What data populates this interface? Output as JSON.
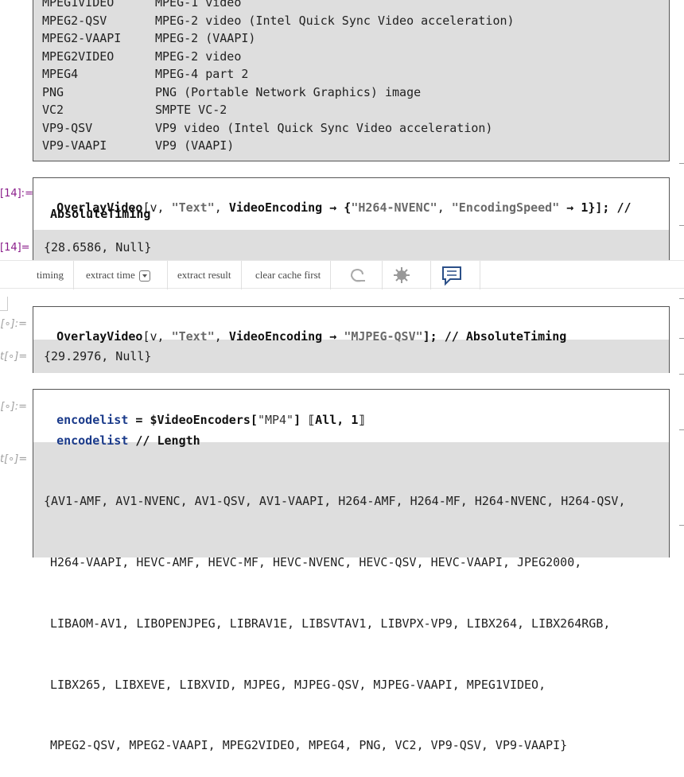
{
  "top_table": {
    "rows": [
      {
        "name": "MPEG1VIDEO",
        "desc": "MPEG-1 video"
      },
      {
        "name": "MPEG2-QSV",
        "desc": "MPEG-2 video (Intel Quick Sync Video acceleration)"
      },
      {
        "name": "MPEG2-VAAPI",
        "desc": "MPEG-2 (VAAPI)"
      },
      {
        "name": "MPEG2VIDEO",
        "desc": "MPEG-2 video"
      },
      {
        "name": "MPEG4",
        "desc": "MPEG-4 part 2"
      },
      {
        "name": "PNG",
        "desc": "PNG (Portable Network Graphics) image"
      },
      {
        "name": "VC2",
        "desc": "SMPTE VC-2"
      },
      {
        "name": "VP9-QSV",
        "desc": "VP9 video (Intel Quick Sync Video acceleration)"
      },
      {
        "name": "VP9-VAAPI",
        "desc": "VP9 (VAAPI)"
      }
    ]
  },
  "cell14": {
    "in_label": "[14]:=",
    "out_label": "[14]=",
    "fn": "OverlayVideo",
    "open": "[v, ",
    "str_text": "\"Text\"",
    "comma1": ", ",
    "opt": "VideoEncoding",
    "arrow": " → {",
    "str_enc": "\"H264-NVENC\"",
    "comma2": ", ",
    "str_speed": "\"EncodingSpeed\"",
    "arrow2": " → 1}]; //",
    "line2": "AbsoluteTiming",
    "output": "{28.6586, Null}"
  },
  "toolbar": {
    "timing": "timing",
    "extract_time": "extract time",
    "extract_result": "extract result",
    "clear_cache": "clear cache first"
  },
  "cell_mjpeg": {
    "in_label": "[∘]:=",
    "out_label": "t[∘]=",
    "fn": "OverlayVideo",
    "open": "[v, ",
    "str_text": "\"Text\"",
    "comma": ", ",
    "opt": "VideoEncoding",
    "arrow": " → ",
    "str_enc": "\"MJPEG-QSV\"",
    "tail": "]; // AbsoluteTiming",
    "output": "{29.2976, Null}"
  },
  "cell_list": {
    "in_label": "[∘]:=",
    "out_label": "t[∘]=",
    "var": "encodelist",
    "eq": " = $VideoEncoders[",
    "str_mp4": "\"MP4\"",
    "part": "] ⟦All, 1⟧",
    "var2": "encodelist",
    "tail2": " // Length",
    "output_lines": [
      "{AV1-AMF, AV1-NVENC, AV1-QSV, AV1-VAAPI, H264-AMF, H264-MF, H264-NVENC, H264-QSV,",
      "H264-VAAPI, HEVC-AMF, HEVC-MF, HEVC-NVENC, HEVC-QSV, HEVC-VAAPI, JPEG2000,",
      "LIBAOM-AV1, LIBOPENJPEG, LIBRAV1E, LIBSVTAV1, LIBVPX-VP9, LIBX264, LIBX264RGB,",
      "LIBX265, LIBXEVE, LIBXVID, MJPEG, MJPEG-QSV, MJPEG-VAAPI, MPEG1VIDEO,",
      "MPEG2-QSV, MPEG2-VAAPI, MPEG2VIDEO, MPEG4, PNG, VC2, VP9-QSV, VP9-VAAPI}"
    ]
  },
  "colors": {
    "output_bg": "#dedede",
    "label_purple": "#8a1d8a",
    "symbol_blue": "#1a3a8a"
  }
}
